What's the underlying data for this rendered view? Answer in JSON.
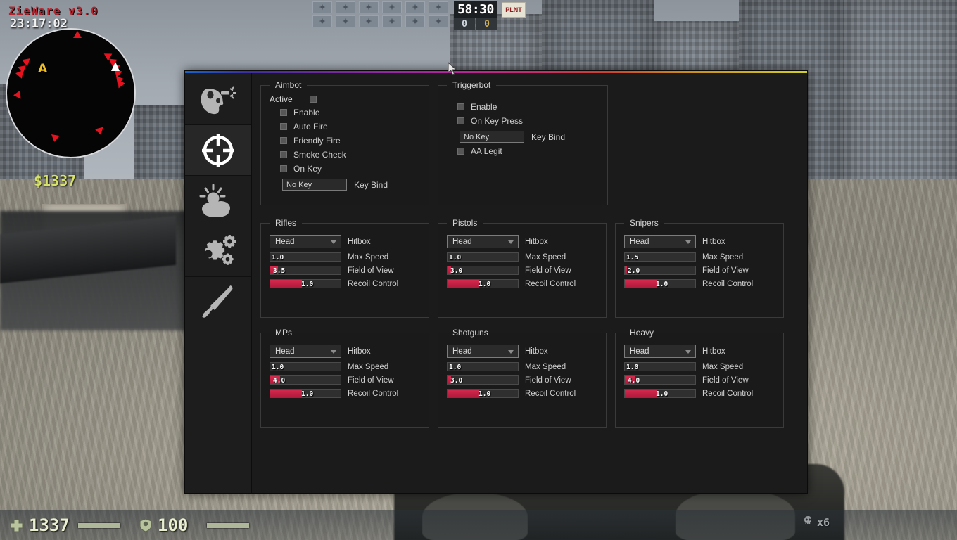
{
  "hud": {
    "cheat_title": "ZieWare v3.0",
    "clock": "23:17:02",
    "money": "$1337",
    "timer": "58:30",
    "score_ct": "0",
    "score_t": "0",
    "bomb_label": "PLNT",
    "health": "1337",
    "armor": "100",
    "ammo": "x6",
    "radar_site_label": "A",
    "player_slot_glyph": "✦",
    "colors": {
      "cheat_title": "#b4252f",
      "money": "#d7e26a",
      "site_marker": "#f2c01e",
      "enemy_blip": "#e8121f",
      "accent_red": "#d42a4e"
    }
  },
  "menu": {
    "sidebar": [
      {
        "name": "aimbot",
        "icon": "head-target-icon",
        "active": false
      },
      {
        "name": "visuals-crosshair",
        "icon": "crosshair-icon",
        "active": true
      },
      {
        "name": "world-weather",
        "icon": "sun-cloud-icon",
        "active": false
      },
      {
        "name": "settings",
        "icon": "gears-icon",
        "active": false
      },
      {
        "name": "skins",
        "icon": "paintbrush-icon",
        "active": false
      }
    ],
    "aimbot": {
      "title": "Aimbot",
      "active_label": "Active",
      "active_checked": false,
      "checkboxes": [
        {
          "label": "Enable",
          "checked": false
        },
        {
          "label": "Auto Fire",
          "checked": false
        },
        {
          "label": "Friendly Fire",
          "checked": false
        },
        {
          "label": "Smoke Check",
          "checked": false
        },
        {
          "label": "On Key",
          "checked": false
        }
      ],
      "keybind_value": "No Key",
      "keybind_label": "Key Bind"
    },
    "triggerbot": {
      "title": "Triggerbot",
      "checkboxes_top": [
        {
          "label": "Enable",
          "checked": false
        },
        {
          "label": "On Key Press",
          "checked": false
        }
      ],
      "keybind_value": "No Key",
      "keybind_label": "Key Bind",
      "checkboxes_bottom": [
        {
          "label": "AA Legit",
          "checked": false
        }
      ]
    },
    "weapon_labels": {
      "hitbox": "Hitbox",
      "max_speed": "Max Speed",
      "field_of_view": "Field of View",
      "recoil_control": "Recoil Control"
    },
    "weapon_groups": [
      {
        "title": "Rifles",
        "hitbox": "Head",
        "max_speed": {
          "value": "1.0",
          "fill_pct": 0
        },
        "field_of_view": {
          "value": "3.5",
          "fill_pct": 11
        },
        "recoil_control": {
          "value": "1.0",
          "fill_pct": 45
        }
      },
      {
        "title": "Pistols",
        "hitbox": "Head",
        "max_speed": {
          "value": "1.0",
          "fill_pct": 0
        },
        "field_of_view": {
          "value": "3.0",
          "fill_pct": 5
        },
        "recoil_control": {
          "value": "1.0",
          "fill_pct": 45
        }
      },
      {
        "title": "Snipers",
        "hitbox": "Head",
        "max_speed": {
          "value": "1.5",
          "fill_pct": 0
        },
        "field_of_view": {
          "value": "2.0",
          "fill_pct": 3
        },
        "recoil_control": {
          "value": "1.0",
          "fill_pct": 45
        }
      },
      {
        "title": "MPs",
        "hitbox": "Head",
        "max_speed": {
          "value": "1.0",
          "fill_pct": 0
        },
        "field_of_view": {
          "value": "4.0",
          "fill_pct": 14
        },
        "recoil_control": {
          "value": "1.0",
          "fill_pct": 45
        }
      },
      {
        "title": "Shotguns",
        "hitbox": "Head",
        "max_speed": {
          "value": "1.0",
          "fill_pct": 0
        },
        "field_of_view": {
          "value": "3.0",
          "fill_pct": 5
        },
        "recoil_control": {
          "value": "1.0",
          "fill_pct": 45
        }
      },
      {
        "title": "Heavy",
        "hitbox": "Head",
        "max_speed": {
          "value": "1.0",
          "fill_pct": 0
        },
        "field_of_view": {
          "value": "4.0",
          "fill_pct": 14
        },
        "recoil_control": {
          "value": "1.0",
          "fill_pct": 45
        }
      }
    ]
  }
}
